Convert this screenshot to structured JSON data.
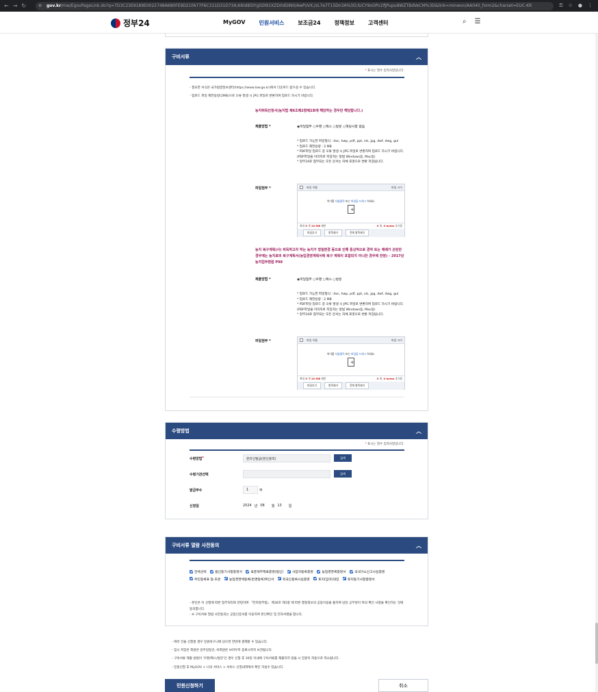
{
  "browser": {
    "host": "gov.kr",
    "path": "/mw/EgovPageLink.do?q=7D3C23E9189E0022748A680FE9D21FA77F6C311D31D73A;K6td85lYgSDl91XZD0dDIN0/AwPzVX;/zL7e7T15Dn3A%3D;lUCY9oOPs1lfJPupu8WZTBdVeCM%3D&link=minwon/AA040_form2&charset=EUC-KR"
  },
  "header": {
    "logo_text": "정부24",
    "nav": [
      "MyGOV",
      "민원서비스",
      "보조금24",
      "정책정보",
      "고객센터"
    ],
    "active_nav": "민원서비스"
  },
  "docs": {
    "title": "구비서류",
    "required_note": "표시는 필수 입력사항입니다.",
    "notes": [
      "- 필요한 서식은 국가법령정보센터(https://www.law.go.kr)에서 다운로드 받으실 수 있습니다.",
      "- 업로드 파일 제한용량(2MB)으로 오류 발생 시 JPG 파일로 변환하여 업로드 하시기 바랍니다."
    ],
    "doc1": {
      "heading": "농지취득인정서(농지법 제6조제2항제2호에 해당하는 경우만 해당합니다.)",
      "method_label": "제출방법",
      "method_options": "◉파일첨부 ○우편 ○팩스 ○방문 ○해당사항 없음",
      "info": [
        "* 업로드 가능한 파일형식 : doc, hwp, pdf, ppt, xls, jpg, dwf, dwg, gul",
        "* 업로드 제한용량 : 2 MB",
        "* PDF파일 업로드 중 오류 발생 시 JPG 파일로 변환하여 업로드 하시기 바랍니다.",
        " (PDF파일을 이미지로 저장하는 방법 Windows용, Mac용)",
        "* 정부24로 첨부되는 모든 문서는 자체 포맷으로 변환 저장됩니다."
      ],
      "file_label": "파일첨부"
    },
    "doc2": {
      "heading": "농지 복구계획(사) 취득하고자 하는 농지가 형질변경 등으로 인해 통상적으로 경작 또는 재배가 곤란한 경우에는 농지로의 복구계획서(농업경영계획서에 복구 계획이 포함되지 아니한 경우에 한정) - 2017년 농지업무편람 P98",
      "method_label": "제출방법",
      "method_options": "◉파일첨부 ○우편 ○팩스 ○방문",
      "info": [
        "* 업로드 가능한 파일형식 : doc, hwp, pdf, ppt, xls, jpg, dwf, dwg, gul",
        "* 업로드 제한용량 : 2 MB",
        "* PDF파일 업로드 중 오류 발생 시 JPG 파일로 변환하여 업로드 하시기 바랍니다.",
        " (PDF파일을 이미지로 저장하는 방법 Windows용, Mac용)",
        "* 정부24로 첨부되는 모든 문서는 자체 포맷으로 변환 저장됩니다."
      ],
      "file_label": "파일첨부"
    },
    "filebox": {
      "col_name": "파일 이름",
      "col_size": "파일 크기",
      "hint_pre": "여기를 ",
      "hint_click": "더블클릭",
      "hint_mid": " 또는 ",
      "hint_drag": "파일을 드래그",
      "hint_post": " 하세요.",
      "limit_pre": "최대",
      "limit_count": "5",
      "limit_mid": "개",
      "limit_size": "10 MB",
      "limit_post": "제한",
      "added_count": "0",
      "added_mid": "개,",
      "added_size": "0 bytes",
      "added_post": "추가됨",
      "btn_add": "파일추가",
      "btn_remove": "항목제거",
      "btn_remove_all": "전체 항목제거"
    }
  },
  "receipt": {
    "title": "수령방법",
    "required_note": "표시는 필수 입력사항입니다.",
    "method_label": "수령방법",
    "method_value": "온라인발급(본인출력)",
    "search_btn": "검색",
    "org_label": "수령기관선택",
    "org_value": "",
    "copies_label": "발급부수",
    "copies_value": "1",
    "copies_unit": "부",
    "date_label": "신청일",
    "date_year": "2024",
    "date_year_unit": "년",
    "date_month": "08",
    "date_month_unit": "월",
    "date_day": "13",
    "date_day_unit": "일"
  },
  "consent": {
    "title": "구비서류 열람 사전동의",
    "items": [
      "전체선택",
      "법인등기사항증명서",
      "표준재무제표증명(법인)",
      "사업자등록증명",
      "농업경영체증명서",
      "국내거소신고사실증명",
      "주민등록표 등·초본",
      "농업경영체등록(변경등록)확인서",
      "외국인등록사실증명",
      "토지(임야)대장",
      "토지등기사항증명서"
    ],
    "note1": "- 본인은 이 신청에 따른 업무처리와 관련하여 「전자정부법」 제36조 제1항 에 따른 행정정보의 공동이용을 통하여 담당 공무원이 위의 확인 사항을 확인하는 것에 동의합니다.",
    "note2": "- ※ 구비서류 열람 사전동의는 공동인증서를 이용하여 본인확인 및 전자서명을 합니다."
  },
  "bottom_notes": [
    "- 여러 건을 신청할 경우 민원바구니에 담으면 한번에 결제할 수 있습니다.",
    "- 임시 저장은 회원은 일주일동안, 비회원은 브라우저 종료시까지 보관됩니다.",
    "- 구비서류 제출 방법이 '우편/팩스/방문'인 경우 신청 후 30일 이내에 구비서류를 제출하지 않을 시 민원이 자동으로 취소됩니다.",
    "- 민원신청 후 MyGOV > 나의 서비스 > 서비스 신청내역에서 확인 하실수 있습니다."
  ],
  "actions": {
    "apply": "민원신청하기",
    "cancel": "취소"
  }
}
